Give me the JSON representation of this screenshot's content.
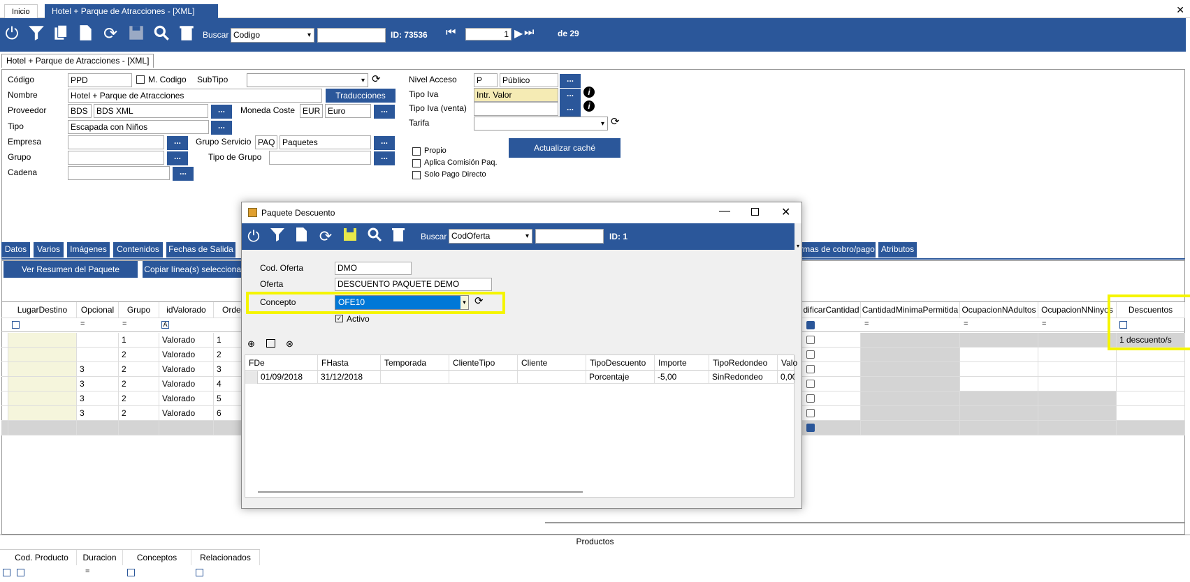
{
  "top_tabs": {
    "home": "Inicio",
    "active": "Hotel + Parque de Atracciones - [XML]"
  },
  "toolbar": {
    "buscar_label": "Buscar",
    "search_field": "Codigo",
    "id_text": "ID: 73536",
    "page_value": "1",
    "page_total": "de 29"
  },
  "form_tab": "Hotel + Parque de Atracciones - [XML]",
  "form": {
    "codigo_label": "Código",
    "codigo": "PPD",
    "mcodigo_label": "M. Codigo",
    "subtipo_label": "SubTipo",
    "nombre_label": "Nombre",
    "nombre": "Hotel + Parque de Atracciones",
    "traducciones": "Traducciones",
    "proveedor_label": "Proveedor",
    "proveedor_code": "BDS",
    "proveedor_name": "BDS XML",
    "moneda_label": "Moneda Coste",
    "moneda_code": "EUR",
    "moneda_name": "Euro",
    "tipo_label": "Tipo",
    "tipo": "Escapada con Niños",
    "empresa_label": "Empresa",
    "grupo_servicio_label": "Grupo Servicio",
    "grupo_servicio_code": "PAQ",
    "grupo_servicio_name": "Paquetes",
    "grupo_label": "Grupo",
    "tipo_grupo_label": "Tipo de Grupo",
    "cadena_label": "Cadena",
    "nivel_acceso_label": "Nivel Acceso",
    "nivel_code": "P",
    "nivel_name": "Público",
    "tipo_iva_label": "Tipo Iva",
    "tipo_iva": "Intr. Valor",
    "tipo_iva_venta_label": "Tipo Iva (venta)",
    "tarifa_label": "Tarifa",
    "propio_label": "Propio",
    "aplica_label": "Aplica Comisión Paq.",
    "solo_pago_label": "Solo Pago Directo",
    "actualizar": "Actualizar caché",
    "dots": "..."
  },
  "subtabs": [
    "Datos",
    "Varios",
    "Imágenes",
    "Contenidos",
    "Fechas de Salida",
    "rmas de cobro/pago",
    "Atributos"
  ],
  "actions": {
    "ver_resumen": "Ver Resumen del Paquete",
    "copiar": "Copiar línea(s) seleccionad"
  },
  "grid": {
    "headers": {
      "lugar": "LugarDestino",
      "opcional": "Opcional",
      "grupo": "Grupo",
      "idvalorado": "idValorado",
      "orden": "Orde",
      "modificar": "dificarCantidad",
      "cantmin": "CantidadMinimaPermitida",
      "ocupa": "OcupacionNAdultos",
      "ocupn": "OcupacionNNinyos",
      "descuentos": "Descuentos"
    },
    "rows": [
      {
        "opcional": "",
        "grupo": "1",
        "idvalorado": "Valorado",
        "orden": "1",
        "descuentos": "1 descuento/s"
      },
      {
        "opcional": "",
        "grupo": "2",
        "idvalorado": "Valorado",
        "orden": "2",
        "descuentos": ""
      },
      {
        "opcional": "3",
        "grupo": "2",
        "idvalorado": "Valorado",
        "orden": "3",
        "descuentos": ""
      },
      {
        "opcional": "3",
        "grupo": "2",
        "idvalorado": "Valorado",
        "orden": "4",
        "descuentos": ""
      },
      {
        "opcional": "3",
        "grupo": "2",
        "idvalorado": "Valorado",
        "orden": "5",
        "descuentos": ""
      },
      {
        "opcional": "3",
        "grupo": "2",
        "idvalorado": "Valorado",
        "orden": "6",
        "descuentos": ""
      }
    ]
  },
  "dialog": {
    "title": "Paquete Descuento",
    "buscar_label": "Buscar",
    "search_field": "CodOferta",
    "id_text": "ID: 1",
    "cod_oferta_label": "Cod. Oferta",
    "cod_oferta": "DMO",
    "oferta_label": "Oferta",
    "oferta": "DESCUENTO PAQUETE DEMO",
    "concepto_label": "Concepto",
    "concepto": "OFE10",
    "activo_label": "Activo",
    "headers": {
      "fde": "FDe",
      "fhasta": "FHasta",
      "temporada": "Temporada",
      "clientetipo": "ClienteTipo",
      "cliente": "Cliente",
      "tipodescuento": "TipoDescuento",
      "importe": "Importe",
      "tiporedondeo": "TipoRedondeo",
      "valor": "Valo"
    },
    "row": {
      "fde": "01/09/2018",
      "fhasta": "31/12/2018",
      "tipodescuento": "Porcentaje",
      "importe": "-5,00",
      "tiporedondeo": "SinRedondeo",
      "valor": "0,00"
    }
  },
  "bottom": {
    "title": "Productos",
    "headers": {
      "cod": "Cod. Producto",
      "duracion": "Duracion",
      "conceptos": "Conceptos",
      "relacionados": "Relacionados"
    }
  },
  "colors": {
    "accent": "#2b579a",
    "highlight": "#f5f500",
    "selection": "#0078d7"
  }
}
